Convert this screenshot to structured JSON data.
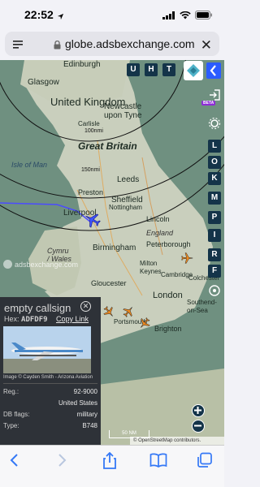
{
  "status": {
    "time": "22:52",
    "location_icon": "location-arrow-icon"
  },
  "url_bar": {
    "url": "globe.adsbexchange.com"
  },
  "map": {
    "labels": {
      "edinburgh": "Edinburgh",
      "glasgow": "Glasgow",
      "united_kingdom": "United Kingdom",
      "newcastle": "Newcastle upon Tyne",
      "carlisle": "Carlisle",
      "great_britain": "Great Britain",
      "isle_of_man": "Isle of Man",
      "leeds": "Leeds",
      "preston": "Preston",
      "liverpool": "Liverpool",
      "sheffield": "Sheffield",
      "nottingham": "Nottingham",
      "lincoln": "Lincoln",
      "england": "England",
      "peterborough": "Peterborough",
      "birmingham": "Birmingham",
      "cymru": "Cymru / Wales",
      "cambridge": "Cambridge",
      "milton_keynes": "Milton Keynes",
      "gloucester": "Gloucester",
      "london": "London",
      "colchester": "Colchester",
      "southend": "Southend-on-Sea",
      "portsmouth": "Portsmouth",
      "brighton": "Brighton",
      "range_100": "100nmi",
      "range_150": "150nmi",
      "watermark": "adsbexchange.com",
      "scale": "50 NM",
      "attribution": "© OpenStreetMap contributors."
    },
    "toolbar": {
      "u": "U",
      "h": "H",
      "t": "T"
    },
    "side_buttons": [
      "L",
      "O",
      "K",
      "M",
      "P",
      "I",
      "R",
      "F"
    ],
    "beta_badge": "BETA"
  },
  "panel": {
    "callsign": "empty callsign",
    "hex_label": "Hex:",
    "hex_value": "ADFDF9",
    "copy_link": "Copy Link",
    "photo_credit": "Image © Cayden Smith - Arizona Aviation",
    "reg_label": "Reg.:",
    "reg_value": "92-9000",
    "country_value": "United States",
    "dbflags_label": "DB flags:",
    "dbflags_value": "military",
    "type_label": "Type:",
    "type_value": "B748"
  },
  "colors": {
    "accent": "#2b5cff",
    "panel_bg": "#2e3238",
    "map_bg": "#6f9080",
    "toolbar_bg": "#143449"
  }
}
